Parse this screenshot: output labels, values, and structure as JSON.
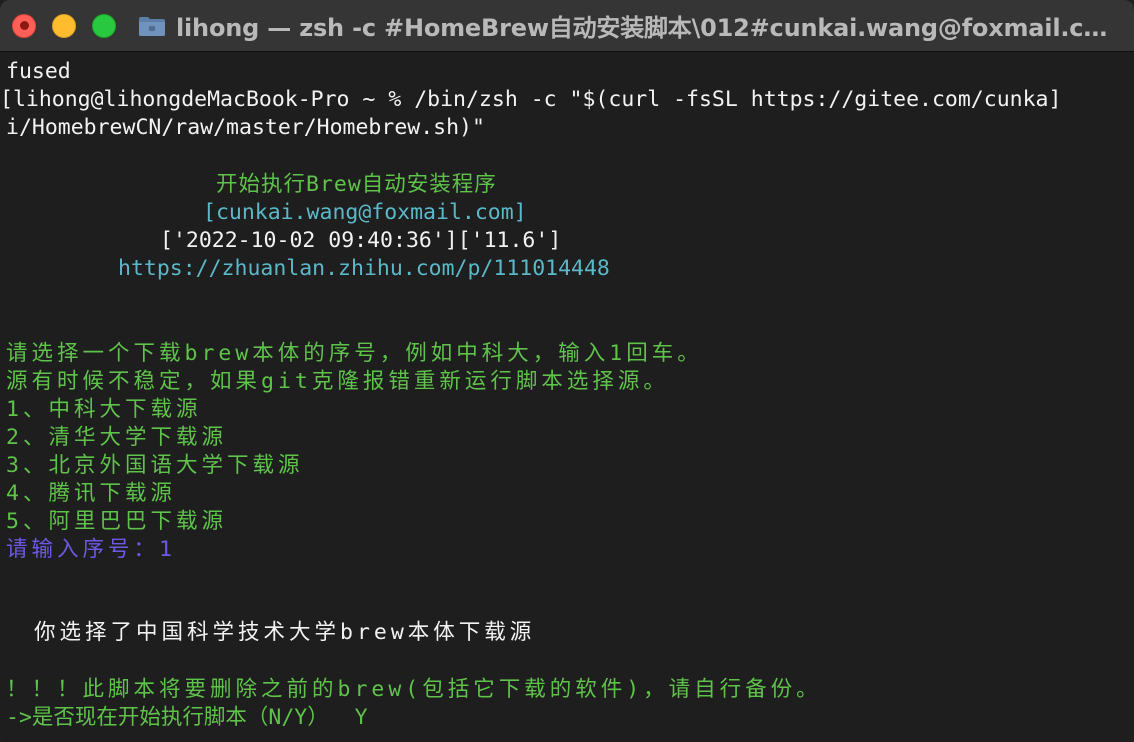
{
  "window": {
    "title": "lihong — zsh -c #HomeBrew自动安装脚本\\012#cunkai.wang@foxmail.com..."
  },
  "terminal": {
    "line_fused": "fused",
    "cmd_line1": "[lihong@lihongdeMacBook-Pro ~ % /bin/zsh -c \"$(curl -fsSL https://gitee.com/cunka]",
    "cmd_line2": "i/HomebrewCN/raw/master/Homebrew.sh)\"",
    "banner_title": "开始执行Brew自动安装程序",
    "banner_email": "[cunkai.wang@foxmail.com]",
    "banner_date": "['2022-10-02 09:40:36']['11.6']",
    "banner_url": "https://zhuanlan.zhihu.com/p/111014448",
    "prompt_choose": "请选择一个下载brew本体的序号，例如中科大，输入1回车。",
    "prompt_note": "源有时候不稳定，如果git克隆报错重新运行脚本选择源。",
    "options": [
      "1、中科大下载源",
      "2、清华大学下载源",
      "3、北京外国语大学下载源",
      "4、腾讯下载源",
      "5、阿里巴巴下载源"
    ],
    "input_prompt": "请输入序号：1",
    "selected_msg": "你选择了中国科学技术大学brew本体下载源",
    "warning": "！！！此脚本将要删除之前的brew(包括它下载的软件)，请自行备份。",
    "confirm": "->是否现在开始执行脚本（N/Y）  Y"
  },
  "colors": {
    "background": "#1e1e1e",
    "text": "#f2f2f2",
    "green": "#5fc24a",
    "cyan": "#5bb8c8",
    "purple": "#6c5ae6"
  }
}
